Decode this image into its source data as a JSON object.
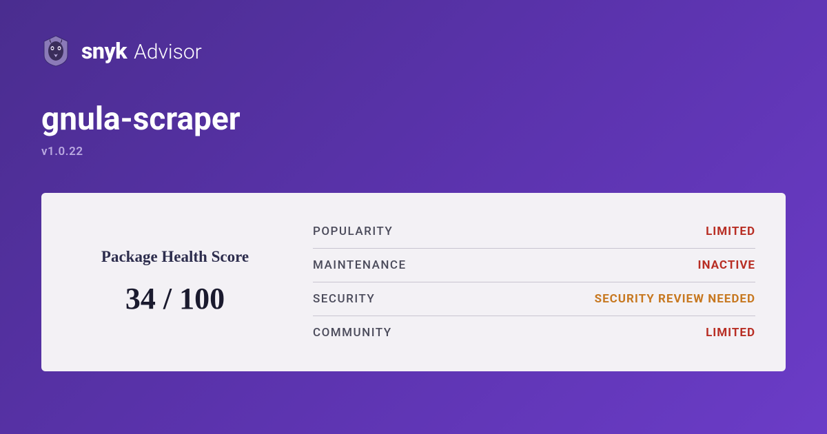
{
  "brand": {
    "name": "snyk",
    "product": "Advisor"
  },
  "package": {
    "name": "gnula-scraper",
    "version": "v1.0.22"
  },
  "score": {
    "label": "Package Health Score",
    "value": "34 / 100"
  },
  "metrics": [
    {
      "label": "POPULARITY",
      "value": "LIMITED",
      "statusClass": "status-red"
    },
    {
      "label": "MAINTENANCE",
      "value": "INACTIVE",
      "statusClass": "status-red"
    },
    {
      "label": "SECURITY",
      "value": "SECURITY REVIEW NEEDED",
      "statusClass": "status-orange"
    },
    {
      "label": "COMMUNITY",
      "value": "LIMITED",
      "statusClass": "status-red"
    }
  ]
}
